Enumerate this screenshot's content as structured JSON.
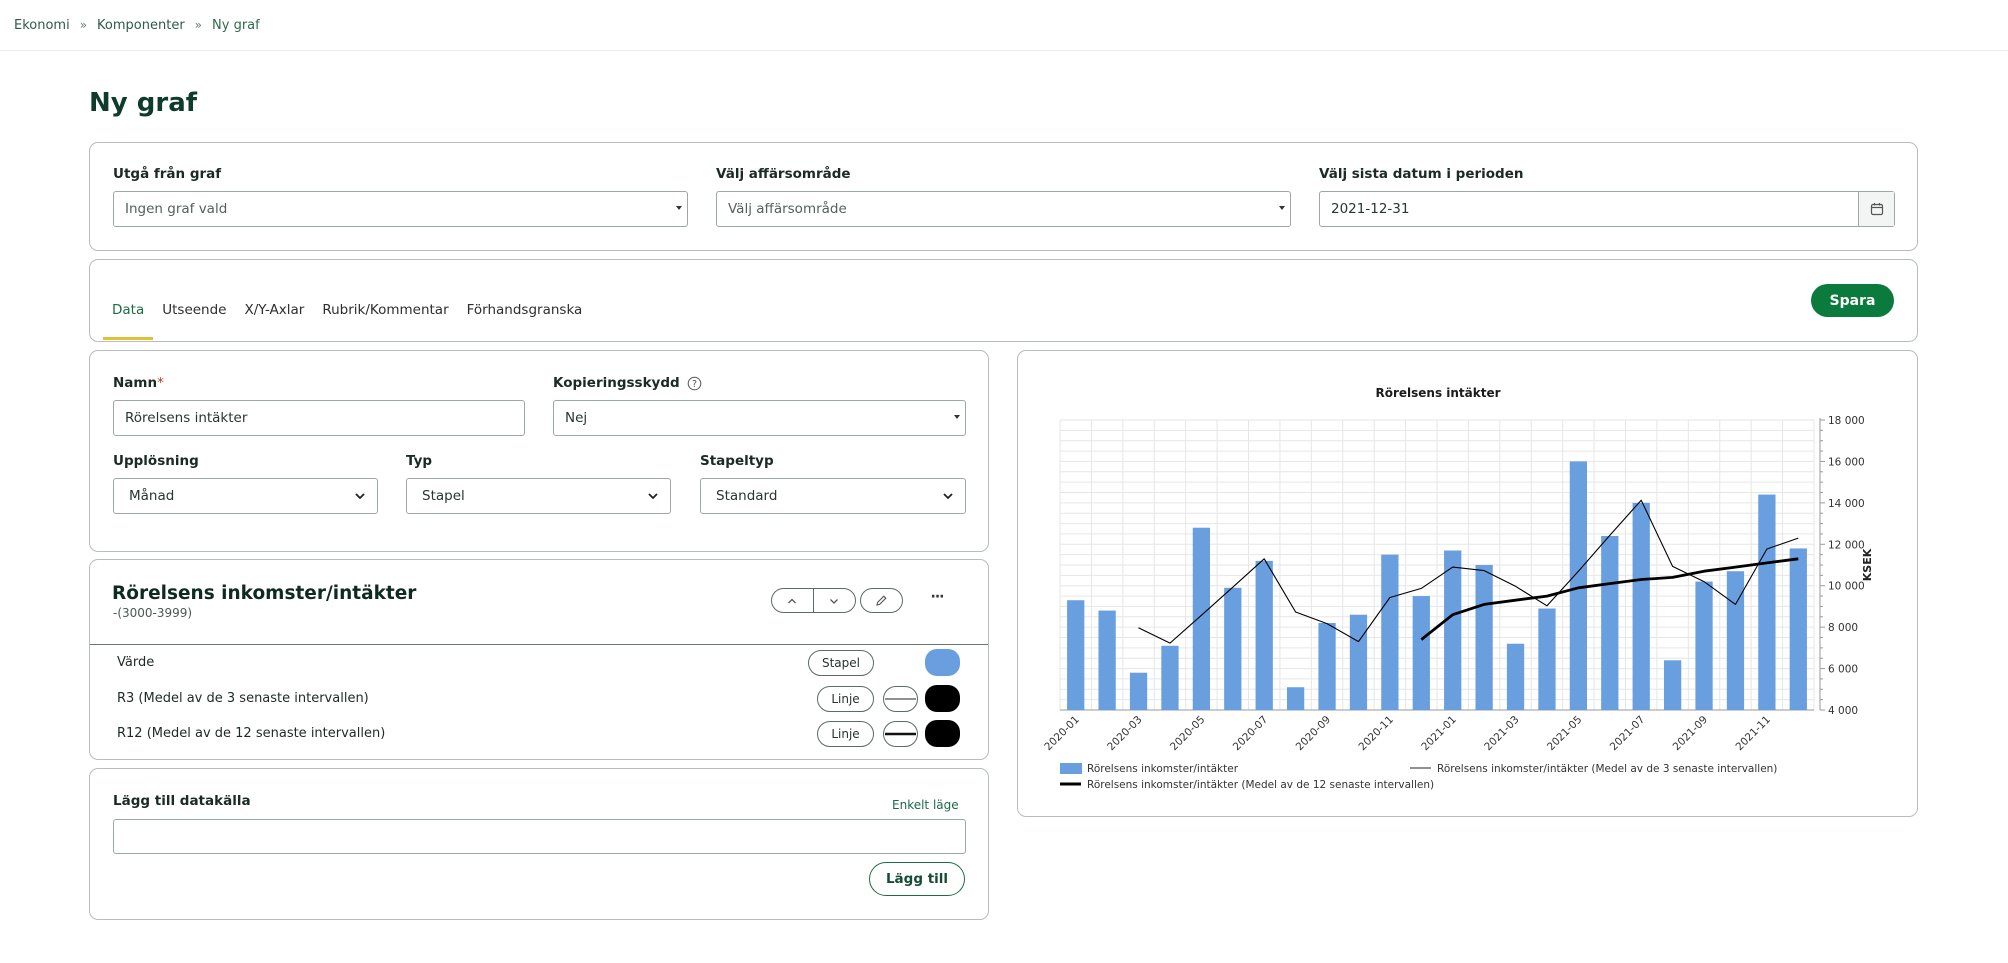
{
  "breadcrumb": [
    "Ekonomi",
    "Komponenter",
    "Ny graf"
  ],
  "page_title": "Ny graf",
  "filters": {
    "base_label": "Utgå från graf",
    "base_value": "Ingen graf vald",
    "area_label": "Välj affärsområde",
    "area_value": "Välj affärsområde",
    "date_label": "Välj sista datum i perioden",
    "date_value": "2021-12-31"
  },
  "tabs": [
    "Data",
    "Utseende",
    "X/Y-Axlar",
    "Rubrik/Kommentar",
    "Förhandsgranska"
  ],
  "save_label": "Spara",
  "form": {
    "name_label": "Namn",
    "required_mark": "*",
    "name_value": "Rörelsens intäkter",
    "copy_label": "Kopieringsskydd",
    "copy_value": "Nej",
    "resolution_label": "Upplösning",
    "resolution_value": "Månad",
    "type_label": "Typ",
    "type_value": "Stapel",
    "bartype_label": "Stapeltyp",
    "bartype_value": "Standard"
  },
  "series_panel": {
    "title": "Rörelsens inkomster/intäkter",
    "subtitle": "-(3000-3999)",
    "menu": "···",
    "rows": [
      {
        "label": "Värde",
        "kind": "Stapel",
        "color": "#6a9fdf"
      },
      {
        "label": "R3 (Medel av de 3 senaste intervallen)",
        "kind": "Linje",
        "color": "#000000"
      },
      {
        "label": "R12 (Medel av de 12 senaste intervallen)",
        "kind": "Linje",
        "color": "#000000"
      }
    ]
  },
  "datasource": {
    "label": "Lägg till datakälla",
    "mode_link": "Enkelt läge",
    "input_value": "",
    "add_label": "Lägg till"
  },
  "colors": {
    "brand_green": "#0a7a3d",
    "tab_underline": "#e2c13a",
    "bar_blue": "#6a9fdf"
  },
  "chart_data": {
    "type": "bar",
    "title": "Rörelsens intäkter",
    "ylabel": "KSEK",
    "xlabel": "",
    "ylim": [
      4000,
      18000
    ],
    "yticks": [
      "4 000",
      "6 000",
      "8 000",
      "10 000",
      "12 000",
      "14 000",
      "16 000",
      "18 000"
    ],
    "categories": [
      "2020-01",
      "2020-02",
      "2020-03",
      "2020-04",
      "2020-05",
      "2020-06",
      "2020-07",
      "2020-08",
      "2020-09",
      "2020-10",
      "2020-11",
      "2020-12",
      "2021-01",
      "2021-02",
      "2021-03",
      "2021-04",
      "2021-05",
      "2021-06",
      "2021-07",
      "2021-08",
      "2021-09",
      "2021-10",
      "2021-11",
      "2021-12"
    ],
    "xtick_labels": [
      "2020-01",
      "2020-03",
      "2020-05",
      "2020-07",
      "2020-09",
      "2020-11",
      "2021-01",
      "2021-03",
      "2021-05",
      "2021-07",
      "2021-09",
      "2021-11"
    ],
    "series": [
      {
        "name": "Rörelsens inkomster/intäkter",
        "kind": "bar",
        "values": [
          9300,
          8800,
          5800,
          7100,
          12800,
          9900,
          11200,
          5100,
          8200,
          8600,
          11500,
          9500,
          11700,
          11000,
          7200,
          8900,
          16000,
          12400,
          14000,
          6400,
          10200,
          10700,
          14400,
          11800
        ]
      },
      {
        "name": "Rörelsens inkomster/intäkter (Medel av de 3 senaste intervallen)",
        "kind": "line",
        "values": [
          null,
          null,
          7970,
          7230,
          8570,
          9930,
          11300,
          8730,
          8170,
          7300,
          9430,
          9870,
          10900,
          10730,
          9970,
          9030,
          10700,
          12430,
          14130,
          10930,
          10200,
          9100,
          11770,
          12300
        ]
      },
      {
        "name": "Rörelsens inkomster/intäkter (Medel av de 12 senaste intervallen)",
        "kind": "line",
        "values": [
          null,
          null,
          null,
          null,
          null,
          null,
          null,
          null,
          null,
          null,
          null,
          7400,
          8600,
          9100,
          9300,
          9500,
          9900,
          10100,
          10300,
          10400,
          10700,
          10900,
          11100,
          11300
        ]
      }
    ],
    "legend_position": "bottom"
  }
}
